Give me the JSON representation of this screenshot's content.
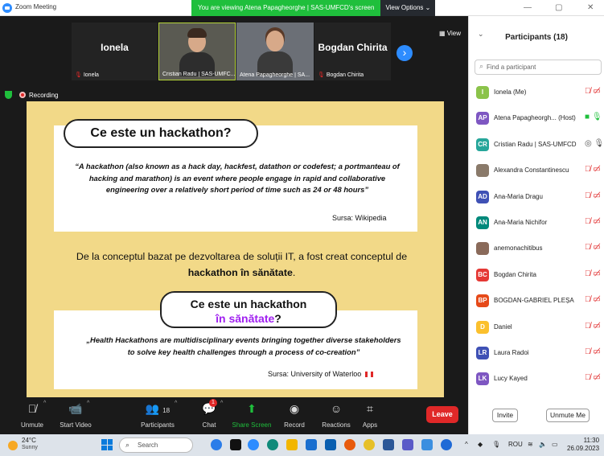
{
  "window": {
    "title": "Zoom Meeting"
  },
  "banner": {
    "viewing_text": "You are viewing Atena Papagheorghe | SAS-UMFCD's screen",
    "view_options": "View Options"
  },
  "video_strip": {
    "tiles": [
      {
        "display_name": "Ionela",
        "label": "Ionela"
      },
      {
        "display_name": "",
        "label": "Cristian Radu | SAS-UMFC..."
      },
      {
        "display_name": "",
        "label": "Atena Papagheorghe | SA..."
      },
      {
        "display_name": "Bogdan Chirita",
        "label": "Bogdan Chirita"
      }
    ],
    "view_label": "View"
  },
  "recording": {
    "label": "Recording"
  },
  "slide": {
    "heading1": "Ce este un hackathon?",
    "quote1": "“A hackathon (also known as a hack day, hackfest, datathon or codefest; a portmanteau of hacking and marathon) is an event where people engage in rapid and collaborative engineering over a relatively short period of time such as 24 or 48 hours”",
    "source1": "Sursa: Wikipedia",
    "paragraph_part1": "De la conceptul bazat pe dezvoltarea de soluții IT, a fost creat conceptul de ",
    "paragraph_bold": "hackathon în sănătate",
    "paragraph_end": ".",
    "heading2_line1": "Ce este un hackathon",
    "heading2_line2_part1": "în sănătate",
    "heading2_line2_part2": "?",
    "quote2": "„Health Hackathons are multidisciplinary events bringing together diverse stakeholders to solve key health challenges through a process of co-creation”",
    "source2": "Sursa: University of Waterloo",
    "accent_color": "#a020f0"
  },
  "toolbar": {
    "unmute": "Unmute",
    "start_video": "Start Video",
    "participants": "Participants",
    "participants_count": "18",
    "chat": "Chat",
    "chat_badge": "1",
    "share_screen": "Share Screen",
    "record": "Record",
    "reactions": "Reactions",
    "apps": "Apps",
    "leave": "Leave"
  },
  "participants_panel": {
    "title": "Participants (18)",
    "search_placeholder": "Find a participant",
    "participants": [
      {
        "initials": "I",
        "name": "Ionela (Me)",
        "color": "#8bc34a",
        "status": "muted"
      },
      {
        "initials": "AP",
        "name": "Atena Papagheorgh... (Host)",
        "color": "#7e57c2",
        "status": "sharing"
      },
      {
        "initials": "CR",
        "name": "Cristian Radu | SAS-UMFCD",
        "color": "#26a69a",
        "status": "mic-on"
      },
      {
        "initials": "",
        "name": "Alexandra Constantinescu",
        "color": "#8a7a6a",
        "status": "muted"
      },
      {
        "initials": "AD",
        "name": "Ana-Maria Dragu",
        "color": "#3f51b5",
        "status": "muted"
      },
      {
        "initials": "AN",
        "name": "Ana-Maria Nichifor",
        "color": "#00897b",
        "status": "muted"
      },
      {
        "initials": "",
        "name": "anemonachitibus",
        "color": "#8a6a5a",
        "status": "muted"
      },
      {
        "initials": "BC",
        "name": "Bogdan Chirita",
        "color": "#e53935",
        "status": "muted"
      },
      {
        "initials": "BP",
        "name": "BOGDAN-GABRIEL PLEȘA",
        "color": "#e64a19",
        "status": "muted"
      },
      {
        "initials": "D",
        "name": "Daniel",
        "color": "#fbc02d",
        "status": "muted"
      },
      {
        "initials": "LR",
        "name": "Laura Radoi",
        "color": "#3f51b5",
        "status": "muted"
      },
      {
        "initials": "LK",
        "name": "Lucy Kayed",
        "color": "#7e57c2",
        "status": "muted"
      }
    ],
    "invite": "Invite",
    "unmute_me": "Unmute Me"
  },
  "taskbar": {
    "temperature": "24°C",
    "weather": "Sunny",
    "search": "Search",
    "language": "ROU",
    "time": "11:30",
    "date": "26.09.2023"
  }
}
